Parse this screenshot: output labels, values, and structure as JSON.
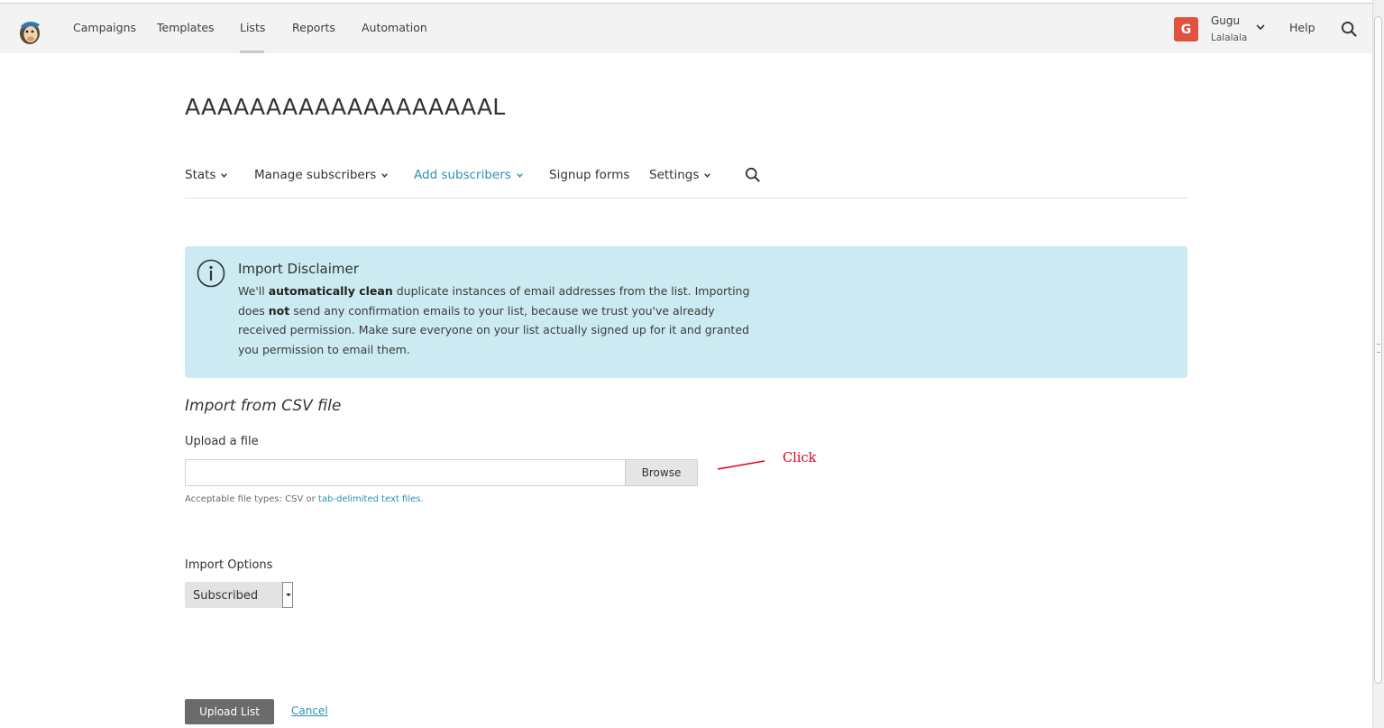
{
  "topnav": {
    "items": [
      "Campaigns",
      "Templates",
      "Lists",
      "Reports",
      "Automation"
    ],
    "active": "Lists",
    "user": {
      "initial": "G",
      "name": "Gugu",
      "org": "Lalalala"
    },
    "help": "Help"
  },
  "page": {
    "title": "AAAAAAAAAAAAAAAAAAAL"
  },
  "subnav": {
    "items": [
      "Stats",
      "Manage subscribers",
      "Add subscribers",
      "Signup forms",
      "Settings"
    ],
    "active": "Add subscribers"
  },
  "disclaimer": {
    "title": "Import Disclaimer",
    "t1": "We'll ",
    "b1": "automatically clean",
    "t2": " duplicate instances of email addresses from the list. Importing does ",
    "b2": "not",
    "t3": " send any confirmation emails to your list, because we trust you've already received permission. Make sure everyone on your list actually signed up for it and granted you permission to email them."
  },
  "import": {
    "heading": "Import from CSV file",
    "upload_label": "Upload a file",
    "browse": "Browse",
    "help_prefix": "Acceptable file types: CSV or ",
    "help_link": "tab-delimited text files.",
    "options_label": "Import Options",
    "option_value": "Subscribed"
  },
  "annotation": {
    "text": "Click",
    "color": "#e0001b"
  },
  "actions": {
    "upload": "Upload List",
    "cancel": "Cancel"
  },
  "colors": {
    "accent": "#2b91b1",
    "avatar": "#e0543f",
    "banner": "#cbeaf1"
  }
}
